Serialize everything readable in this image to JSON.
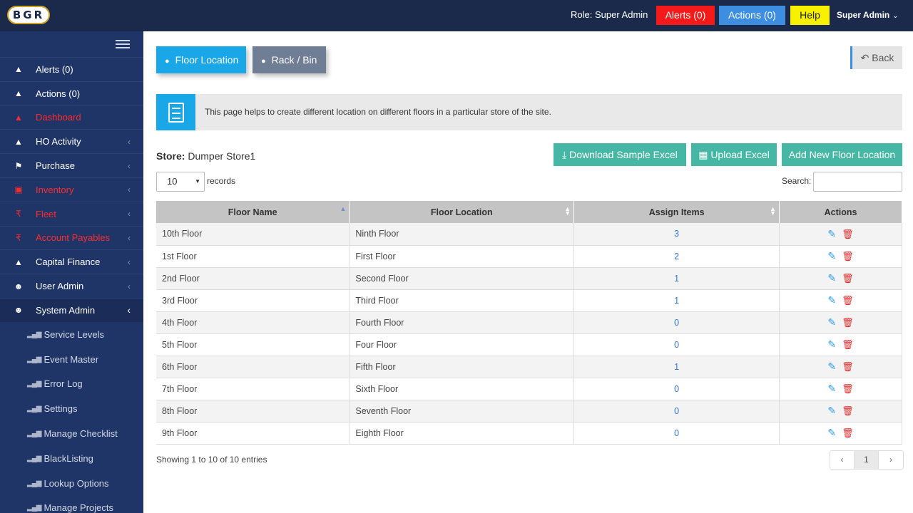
{
  "header": {
    "logo_text": "BGR",
    "role_text": "Role: Super Admin",
    "alerts_label": "Alerts (0)",
    "actions_label": "Actions (0)",
    "help_label": "Help",
    "user_label": "Super Admin",
    "colors": {
      "alerts": "#f41a1a",
      "actions": "#3d8ee0",
      "help": "#f7f100",
      "bar": "#1b2a4a"
    }
  },
  "sidebar": {
    "items": [
      {
        "label": "Alerts (0)",
        "icon": "area-chart-icon"
      },
      {
        "label": "Actions (0)",
        "icon": "area-chart-icon"
      },
      {
        "label": "Dashboard",
        "icon": "area-chart-icon"
      },
      {
        "label": "HO Activity",
        "icon": "area-chart-icon"
      },
      {
        "label": "Purchase",
        "icon": "flag-icon"
      },
      {
        "label": "Inventory",
        "icon": "box-icon"
      },
      {
        "label": "Fleet",
        "icon": "rupee-icon"
      },
      {
        "label": "Account Payables",
        "icon": "rupee-icon"
      },
      {
        "label": "Capital Finance",
        "icon": "area-chart-icon"
      },
      {
        "label": "User Admin",
        "icon": "users-icon"
      },
      {
        "label": "System Admin",
        "icon": "users-icon"
      }
    ],
    "sub_items": [
      {
        "label": "Service Levels"
      },
      {
        "label": "Event Master"
      },
      {
        "label": "Error Log"
      },
      {
        "label": "Settings"
      },
      {
        "label": "Manage Checklist"
      },
      {
        "label": "BlackListing"
      },
      {
        "label": "Lookup Options"
      },
      {
        "label": "Manage Projects"
      }
    ]
  },
  "tabs": {
    "floor_location": "Floor Location",
    "rack_bin": "Rack / Bin"
  },
  "back_label": "Back",
  "info_text": "This page helps to create different location on different floors in a particular store of the site.",
  "store": {
    "label": "Store:",
    "value": "Dumper Store1"
  },
  "buttons": {
    "download": "Download Sample Excel",
    "upload": "Upload Excel",
    "add_new": "Add New Floor Location"
  },
  "records": {
    "selected": "10",
    "label": "records"
  },
  "search": {
    "label": "Search:",
    "value": ""
  },
  "table": {
    "headers": [
      "Floor Name",
      "Floor Location",
      "Assign Items",
      "Actions"
    ],
    "rows": [
      {
        "floor_name": "10th Floor",
        "floor_location": "Ninth Floor",
        "assign_items": "3"
      },
      {
        "floor_name": "1st Floor",
        "floor_location": "First Floor",
        "assign_items": "2"
      },
      {
        "floor_name": "2nd Floor",
        "floor_location": "Second Floor",
        "assign_items": "1"
      },
      {
        "floor_name": "3rd Floor",
        "floor_location": "Third Floor",
        "assign_items": "1"
      },
      {
        "floor_name": "4th Floor",
        "floor_location": "Fourth Floor",
        "assign_items": "0"
      },
      {
        "floor_name": "5th Floor",
        "floor_location": "Four Floor",
        "assign_items": "0"
      },
      {
        "floor_name": "6th Floor",
        "floor_location": "Fifth Floor",
        "assign_items": "1"
      },
      {
        "floor_name": "7th Floor",
        "floor_location": "Sixth Floor",
        "assign_items": "0"
      },
      {
        "floor_name": "8th Floor",
        "floor_location": "Seventh Floor",
        "assign_items": "0"
      },
      {
        "floor_name": "9th Floor",
        "floor_location": "Eighth Floor",
        "assign_items": "0"
      }
    ]
  },
  "footer": {
    "info": "Showing 1 to 10 of 10 entries",
    "current_page": "1"
  }
}
